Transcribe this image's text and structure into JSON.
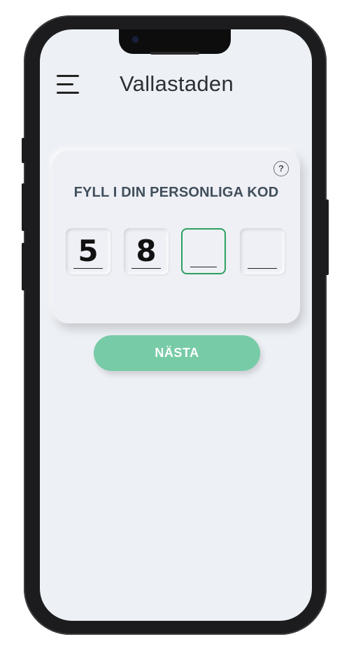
{
  "header": {
    "title": "Vallastaden",
    "menu_icon": "hamburger-menu-icon"
  },
  "card": {
    "title": "FYLL I DIN PERSONLIGA KOD",
    "help_icon": "question-mark-icon",
    "help_glyph": "?",
    "digits": [
      "5",
      "8",
      "",
      ""
    ],
    "active_digit_index": 2
  },
  "actions": {
    "next_label": "NÄSTA"
  },
  "colors": {
    "accent_green": "#2da060",
    "button_green": "#77cba7",
    "screen_background": "#edf0f5",
    "title_text": "#414e5b"
  }
}
